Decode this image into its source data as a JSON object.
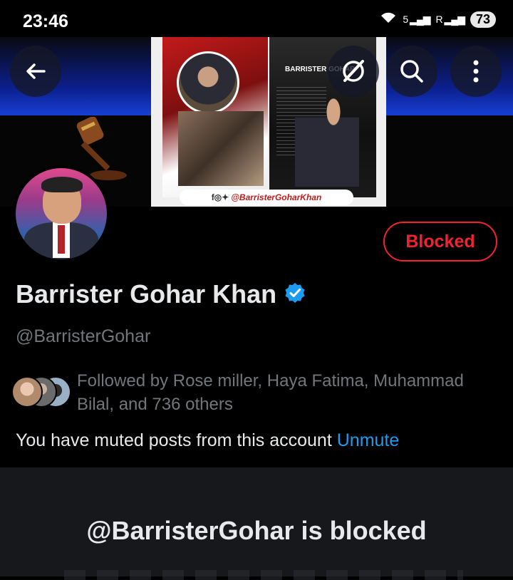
{
  "status_bar": {
    "time": "23:46",
    "signal_1": "5",
    "signal_2": "R",
    "battery": "73"
  },
  "header": {
    "back_icon": "back-arrow-icon",
    "grok_icon": "grok-icon",
    "search_icon": "search-icon",
    "more_icon": "more-vertical-icon"
  },
  "banner": {
    "magazine_title": "BARRISTER GOHAR",
    "magazine_handle": "@BarristerGoharKhan"
  },
  "profile": {
    "blocked_label": "Blocked",
    "name": "Barrister Gohar Khan",
    "verified": true,
    "handle": "@BarristerGohar",
    "followed_by": "Followed by Rose miller, Haya Fatima, Muhammad Bilal, and 736 others",
    "muted_text": "You have muted posts from this account",
    "unmute_label": "Unmute"
  },
  "blocked_section": {
    "heading": "@BarristerGohar is blocked"
  },
  "colors": {
    "background": "#000000",
    "accent": "#1d9bf0",
    "danger": "#f4212e",
    "secondary_text": "#71767b"
  }
}
